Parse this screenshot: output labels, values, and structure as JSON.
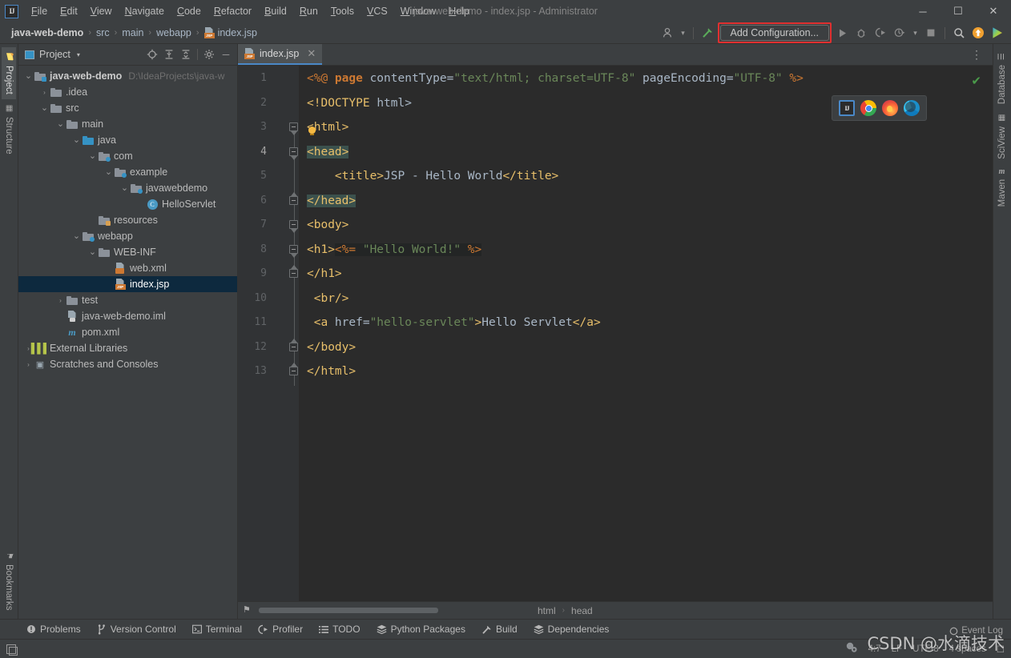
{
  "window": {
    "title": "java-web-demo - index.jsp - Administrator",
    "minimize": "─",
    "maximize": "☐",
    "close": "✕",
    "logo": "IJ"
  },
  "menu": {
    "items": [
      {
        "label": "File"
      },
      {
        "label": "Edit"
      },
      {
        "label": "View"
      },
      {
        "label": "Navigate"
      },
      {
        "label": "Code"
      },
      {
        "label": "Refactor"
      },
      {
        "label": "Build"
      },
      {
        "label": "Run"
      },
      {
        "label": "Tools"
      },
      {
        "label": "VCS"
      },
      {
        "label": "Window"
      },
      {
        "label": "Help"
      }
    ]
  },
  "navbar": {
    "breadcrumbs": [
      {
        "label": "java-web-demo",
        "bold": true
      },
      {
        "label": "src"
      },
      {
        "label": "main"
      },
      {
        "label": "webapp"
      },
      {
        "label": "index.jsp",
        "icon": "jsp-file-icon"
      }
    ],
    "separator": "›",
    "add_configuration_label": "Add Configuration...",
    "highlight_color": "#e03030",
    "icons": {
      "user": "👤",
      "dropdown": "▾",
      "build_hammer": "⬈",
      "run": "▶",
      "debug": "🐞",
      "run_coverage": "▶",
      "profile": "▶",
      "stop": "■",
      "search": "🔍",
      "update": "⬆",
      "ij_run": "▶"
    }
  },
  "left_stripe": {
    "tabs": [
      {
        "label": "Project",
        "active": true,
        "icon": "project-folder-icon"
      },
      {
        "label": "Structure",
        "active": false,
        "icon": "structure-icon"
      }
    ],
    "bottom_tabs": [
      {
        "label": "Bookmarks",
        "icon": "bookmark-flag-icon"
      }
    ]
  },
  "right_stripe": {
    "tabs": [
      {
        "label": "Database",
        "icon": "database-icon"
      },
      {
        "label": "SciView",
        "icon": "sciview-grid-icon"
      },
      {
        "label": "Maven",
        "icon": "maven-m-icon"
      }
    ]
  },
  "project_panel": {
    "title": "Project",
    "caret": "▾",
    "tools": [
      {
        "name": "locate-icon",
        "glyph": "⊕"
      },
      {
        "name": "expand-all-icon",
        "glyph": "⥣"
      },
      {
        "name": "collapse-all-icon",
        "glyph": "⥢"
      },
      {
        "name": "settings-gear-icon",
        "glyph": "⚙"
      },
      {
        "name": "hide-panel-icon",
        "glyph": "─"
      }
    ],
    "tree": [
      {
        "label": "java-web-demo",
        "path": "D:\\IdeaProjects\\java-w",
        "indent": 0,
        "arrow": "⌄",
        "icon": "module-folder-icon",
        "bold": true,
        "selected": false
      },
      {
        "label": ".idea",
        "indent": 1,
        "arrow": "›",
        "icon": "folder-icon",
        "selected": false
      },
      {
        "label": "src",
        "indent": 1,
        "arrow": "⌄",
        "icon": "folder-icon",
        "selected": false
      },
      {
        "label": "main",
        "indent": 2,
        "arrow": "⌄",
        "icon": "folder-icon",
        "selected": false
      },
      {
        "label": "java",
        "indent": 3,
        "arrow": "⌄",
        "icon": "source-folder-icon",
        "selected": false
      },
      {
        "label": "com",
        "indent": 4,
        "arrow": "⌄",
        "icon": "package-icon",
        "selected": false
      },
      {
        "label": "example",
        "indent": 5,
        "arrow": "⌄",
        "icon": "package-icon",
        "selected": false
      },
      {
        "label": "javawebdemo",
        "indent": 6,
        "arrow": "⌄",
        "icon": "package-icon",
        "selected": false
      },
      {
        "label": "HelloServlet",
        "indent": 7,
        "arrow": "",
        "icon": "java-class-icon",
        "selected": false
      },
      {
        "label": "resources",
        "indent": 4,
        "arrow": "",
        "icon": "resource-folder-icon",
        "selected": false
      },
      {
        "label": "webapp",
        "indent": 3,
        "arrow": "⌄",
        "icon": "webapp-folder-icon",
        "selected": false
      },
      {
        "label": "WEB-INF",
        "indent": 4,
        "arrow": "⌄",
        "icon": "folder-icon",
        "selected": false
      },
      {
        "label": "web.xml",
        "indent": 5,
        "arrow": "",
        "icon": "xml-file-icon",
        "selected": false
      },
      {
        "label": "index.jsp",
        "indent": 5,
        "arrow": "",
        "icon": "jsp-file-icon",
        "selected": true
      },
      {
        "label": "test",
        "indent": 2,
        "arrow": "›",
        "icon": "folder-icon",
        "selected": false
      },
      {
        "label": "java-web-demo.iml",
        "indent": 2,
        "arrow": "",
        "icon": "iml-file-icon",
        "selected": false
      },
      {
        "label": "pom.xml",
        "indent": 2,
        "arrow": "",
        "icon": "maven-pom-icon",
        "selected": false
      },
      {
        "label": "External Libraries",
        "indent": 0,
        "arrow": "›",
        "icon": "libraries-icon",
        "selected": false
      },
      {
        "label": "Scratches and Consoles",
        "indent": 0,
        "arrow": "›",
        "icon": "scratches-icon",
        "selected": false
      }
    ]
  },
  "editor": {
    "tab": {
      "label": "index.jsp",
      "icon": "jsp-file-icon",
      "close": "✕"
    },
    "options_glyph": "⋮",
    "inspection_status": "✔",
    "cursor_line": 4,
    "lines": [
      {
        "num": 1,
        "fold": "",
        "tokens": [
          {
            "t": "<%@ ",
            "c": "tok-dir"
          },
          {
            "t": "page",
            "c": "tok-kw"
          },
          {
            "t": " contentType=",
            "c": "tok-txt"
          },
          {
            "t": "\"text/html; charset=UTF-8\"",
            "c": "tok-str"
          },
          {
            "t": " pageEncoding=",
            "c": "tok-txt"
          },
          {
            "t": "\"UTF-8\"",
            "c": "tok-str"
          },
          {
            "t": " %>",
            "c": "tok-dir"
          }
        ]
      },
      {
        "num": 2,
        "fold": "",
        "tokens": [
          {
            "t": "<!DOCTYPE ",
            "c": "tok-tag"
          },
          {
            "t": "html>",
            "c": "tok-txt"
          }
        ]
      },
      {
        "num": 3,
        "fold": "open",
        "tokens": [
          {
            "t": "<html>",
            "c": "tok-tag"
          }
        ]
      },
      {
        "num": 4,
        "fold": "open",
        "tokens": [
          {
            "t": "<head>",
            "c": "tok-tag",
            "hl": "hl-tag"
          }
        ]
      },
      {
        "num": 5,
        "fold": "",
        "tokens": [
          {
            "t": "    <title>",
            "c": "tok-tag"
          },
          {
            "t": "JSP - Hello World",
            "c": "tok-txt"
          },
          {
            "t": "</title>",
            "c": "tok-tag"
          }
        ]
      },
      {
        "num": 6,
        "fold": "close",
        "tokens": [
          {
            "t": "</head>",
            "c": "tok-tag",
            "hl": "hl-tag"
          }
        ]
      },
      {
        "num": 7,
        "fold": "open",
        "tokens": [
          {
            "t": "<body>",
            "c": "tok-tag"
          }
        ]
      },
      {
        "num": 8,
        "fold": "open",
        "tokens": [
          {
            "t": "<h1>",
            "c": "tok-tag"
          },
          {
            "t": "<%= ",
            "c": "tok-dir",
            "hl": "hl-scriptlet"
          },
          {
            "t": "\"Hello World!\"",
            "c": "tok-str",
            "hl": "hl-scriptlet"
          },
          {
            "t": " %>",
            "c": "tok-dir",
            "hl": "hl-scriptlet"
          }
        ]
      },
      {
        "num": 9,
        "fold": "close",
        "tokens": [
          {
            "t": "</h1>",
            "c": "tok-tag"
          }
        ]
      },
      {
        "num": 10,
        "fold": "",
        "tokens": [
          {
            "t": " <br/>",
            "c": "tok-tag"
          }
        ]
      },
      {
        "num": 11,
        "fold": "",
        "tokens": [
          {
            "t": " <a ",
            "c": "tok-tag"
          },
          {
            "t": "href=",
            "c": "tok-attrname"
          },
          {
            "t": "\"hello-servlet\"",
            "c": "tok-str"
          },
          {
            "t": ">",
            "c": "tok-tag"
          },
          {
            "t": "Hello Servlet",
            "c": "tok-txt"
          },
          {
            "t": "</a>",
            "c": "tok-tag"
          }
        ]
      },
      {
        "num": 12,
        "fold": "close",
        "tokens": [
          {
            "t": "</body>",
            "c": "tok-tag"
          }
        ]
      },
      {
        "num": 13,
        "fold": "close",
        "tokens": [
          {
            "t": "</html>",
            "c": "tok-tag"
          }
        ]
      }
    ],
    "browser_popup": [
      {
        "name": "intellij-browser-icon",
        "label": "IJ"
      },
      {
        "name": "chrome-browser-icon",
        "label": ""
      },
      {
        "name": "firefox-browser-icon",
        "label": ""
      },
      {
        "name": "edge-browser-icon",
        "label": ""
      }
    ],
    "breadcrumb": {
      "items": [
        "html",
        "head"
      ],
      "separator": "›"
    }
  },
  "bottom_tabs": [
    {
      "label": "Problems",
      "icon": "problems-icon",
      "glyph": "❕"
    },
    {
      "label": "Version Control",
      "icon": "version-control-icon",
      "glyph": "⑂"
    },
    {
      "label": "Terminal",
      "icon": "terminal-icon",
      "glyph": "▣"
    },
    {
      "label": "Profiler",
      "icon": "profiler-icon",
      "glyph": "◔"
    },
    {
      "label": "TODO",
      "icon": "todo-icon",
      "glyph": "☰"
    },
    {
      "label": "Python Packages",
      "icon": "python-packages-icon",
      "glyph": "≣"
    },
    {
      "label": "Build",
      "icon": "build-hammer-icon",
      "glyph": "⬈"
    },
    {
      "label": "Dependencies",
      "icon": "dependencies-icon",
      "glyph": "≣"
    }
  ],
  "statusbar": {
    "event_log": "Event Log",
    "event_log_icon": "○",
    "notification_icon": "🔔",
    "caret_position": "4:7",
    "line_separator": "LF",
    "encoding": "UTF-8",
    "indent": "4 spaces",
    "lock_icon": "☐"
  },
  "watermark": {
    "text": "CSDN @水滴技术"
  }
}
